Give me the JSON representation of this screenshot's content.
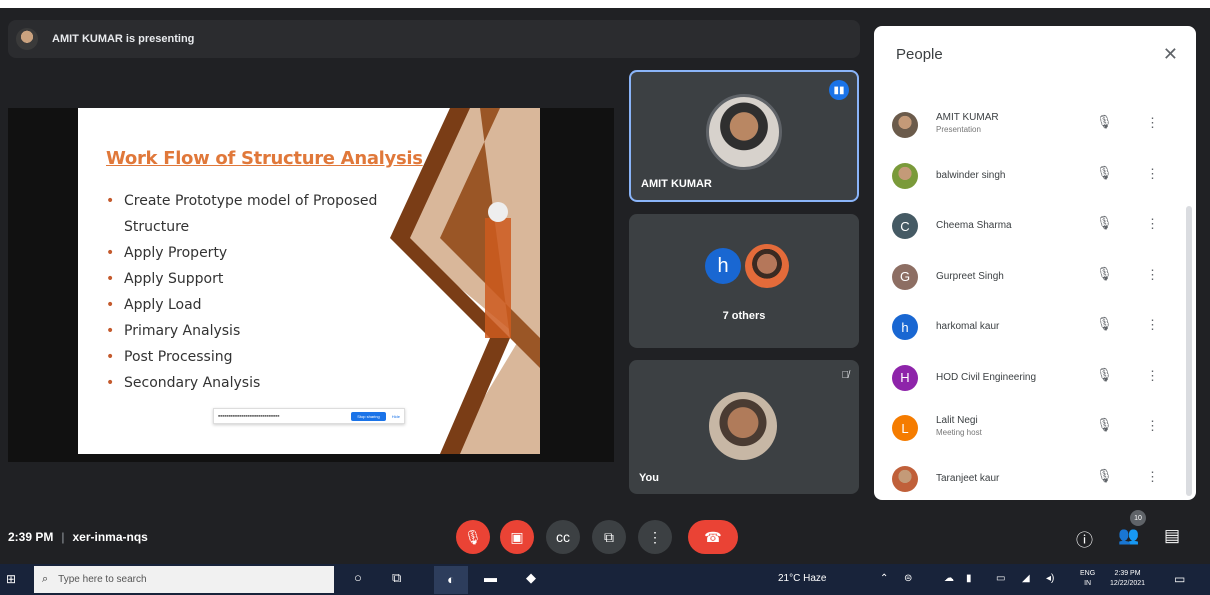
{
  "presenting": {
    "text": "AMIT KUMAR is presenting"
  },
  "slide": {
    "title": "Work Flow of Structure Analysis",
    "bullets": [
      "Create Prototype model of Proposed Structure",
      "Apply Property",
      "Apply Support",
      "Apply Load",
      "Primary Analysis",
      "Post Processing",
      "Secondary Analysis"
    ],
    "popup_button": "Stop sharing",
    "popup_hide": "Hide"
  },
  "tiles": {
    "amit": {
      "name": "AMIT KUMAR"
    },
    "others": {
      "avatar_letter": "h",
      "label": "7 others"
    },
    "you": {
      "name": "You"
    }
  },
  "people": {
    "title": "People",
    "close_icon": "close-icon",
    "rows": [
      {
        "name": "AMIT KUMAR",
        "sub": "Presentation",
        "avatar": "photo",
        "avatar_color": "#6b5b4b"
      },
      {
        "name": "balwinder singh",
        "sub": "",
        "avatar": "photo",
        "avatar_color": "#7a9a3a"
      },
      {
        "name": "Cheema Sharma",
        "sub": "",
        "avatar": "C",
        "avatar_color": "#455a64"
      },
      {
        "name": "Gurpreet Singh",
        "sub": "",
        "avatar": "G",
        "avatar_color": "#8d6e63"
      },
      {
        "name": "harkomal kaur",
        "sub": "",
        "avatar": "h",
        "avatar_color": "#1967d2"
      },
      {
        "name": "HOD Civil Engineering",
        "sub": "",
        "avatar": "H",
        "avatar_color": "#8e24aa"
      },
      {
        "name": "Lalit Negi",
        "sub": "Meeting host",
        "avatar": "L",
        "avatar_color": "#f57c00"
      },
      {
        "name": "Taranjeet kaur",
        "sub": "",
        "avatar": "photo",
        "avatar_color": "#c0603a"
      }
    ]
  },
  "bottom": {
    "time": "2:39 PM",
    "meeting_code": "xer-inma-nqs",
    "participants_badge": "10"
  },
  "taskbar": {
    "search_placeholder": "Type here to search",
    "weather": "21°C Haze",
    "lang_1": "ENG",
    "lang_2": "IN",
    "clock_time": "2:39 PM",
    "clock_date": "12/22/2021"
  },
  "colors": {
    "accent": "#1a73e8",
    "danger": "#ea4335",
    "panel": "#202124",
    "slide_title": "#e0783a"
  }
}
